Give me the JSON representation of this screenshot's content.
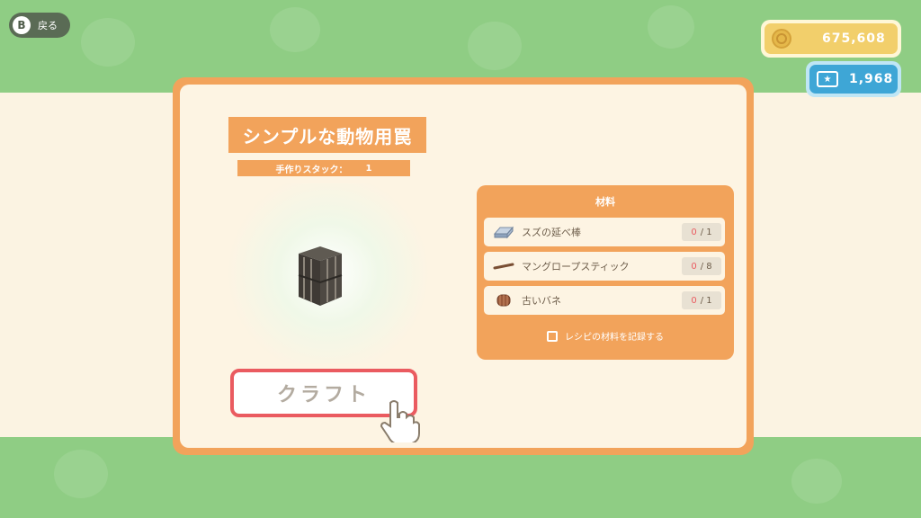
{
  "header": {
    "back_button": {
      "key": "B",
      "label": "戻る"
    }
  },
  "currency": {
    "bells": "675,608",
    "miles": "1,968"
  },
  "recipe": {
    "item_name": "シンプルな動物用罠",
    "stack_label": "手作りスタック：",
    "stack_value": "1",
    "craft_label": "クラフト"
  },
  "materials": {
    "title": "材料",
    "items": [
      {
        "name": "スズの延べ棒",
        "have": "0",
        "need": "/ 1",
        "icon": "tin-bar-icon"
      },
      {
        "name": "マングロープスティック",
        "have": "0",
        "need": "/ 8",
        "icon": "stick-icon"
      },
      {
        "name": "古いバネ",
        "have": "0",
        "need": "/ 1",
        "icon": "spring-icon"
      }
    ],
    "record_label": "レシピの材料を記録する"
  },
  "colors": {
    "accent_orange": "#f2a35b",
    "panel_cream": "#fdf4e3",
    "background_green": "#8fcd84",
    "craft_border_red": "#ea5b60",
    "bells_gold": "#f2cf6b",
    "miles_blue": "#3ea6d6"
  }
}
